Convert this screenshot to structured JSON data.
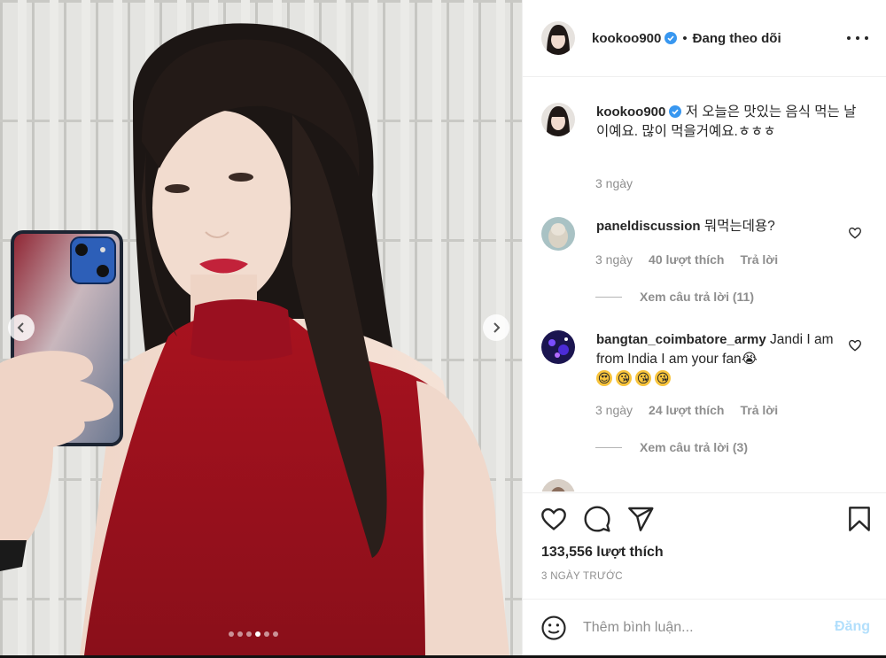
{
  "post_owner": {
    "username": "kookoo900",
    "separator": "•",
    "follow_status": "Đang theo dõi"
  },
  "caption": {
    "username": "kookoo900",
    "text": "저 오늘은 맛있는 음식 먹는 날이예요. 많이 먹을거예요.ㅎㅎㅎ",
    "time": "3 ngày"
  },
  "comments": [
    {
      "username": "paneldiscussion",
      "text": "뭐먹는데용?",
      "time": "3 ngày",
      "likes": "40 lượt thích",
      "reply_label": "Trả lời",
      "view_replies": "Xem câu trả lời (11)"
    },
    {
      "username": "bangtan_coimbatore_army",
      "text": "Jandi I am from India I am your fan😭",
      "emojis": [
        "😍",
        "😘",
        "😘",
        "😘"
      ],
      "time": "3 ngày",
      "likes": "24 lượt thích",
      "reply_label": "Trả lời",
      "view_replies": "Xem câu trả lời (3)"
    }
  ],
  "actions": {
    "like": "heart-icon",
    "comment": "comment-icon",
    "share": "paper-plane-icon",
    "save": "bookmark-icon"
  },
  "likes_label": "133,556 lượt thích",
  "post_date": "3 NGÀY TRƯỚC",
  "comment_box": {
    "placeholder": "Thêm bình luận...",
    "post_label": "Đăng"
  },
  "carousel": {
    "total": 6,
    "active": 3
  },
  "colors": {
    "accent_blue": "#0095f6",
    "post_disabled": "#b2dffc",
    "dress_red": "#b0182a"
  }
}
